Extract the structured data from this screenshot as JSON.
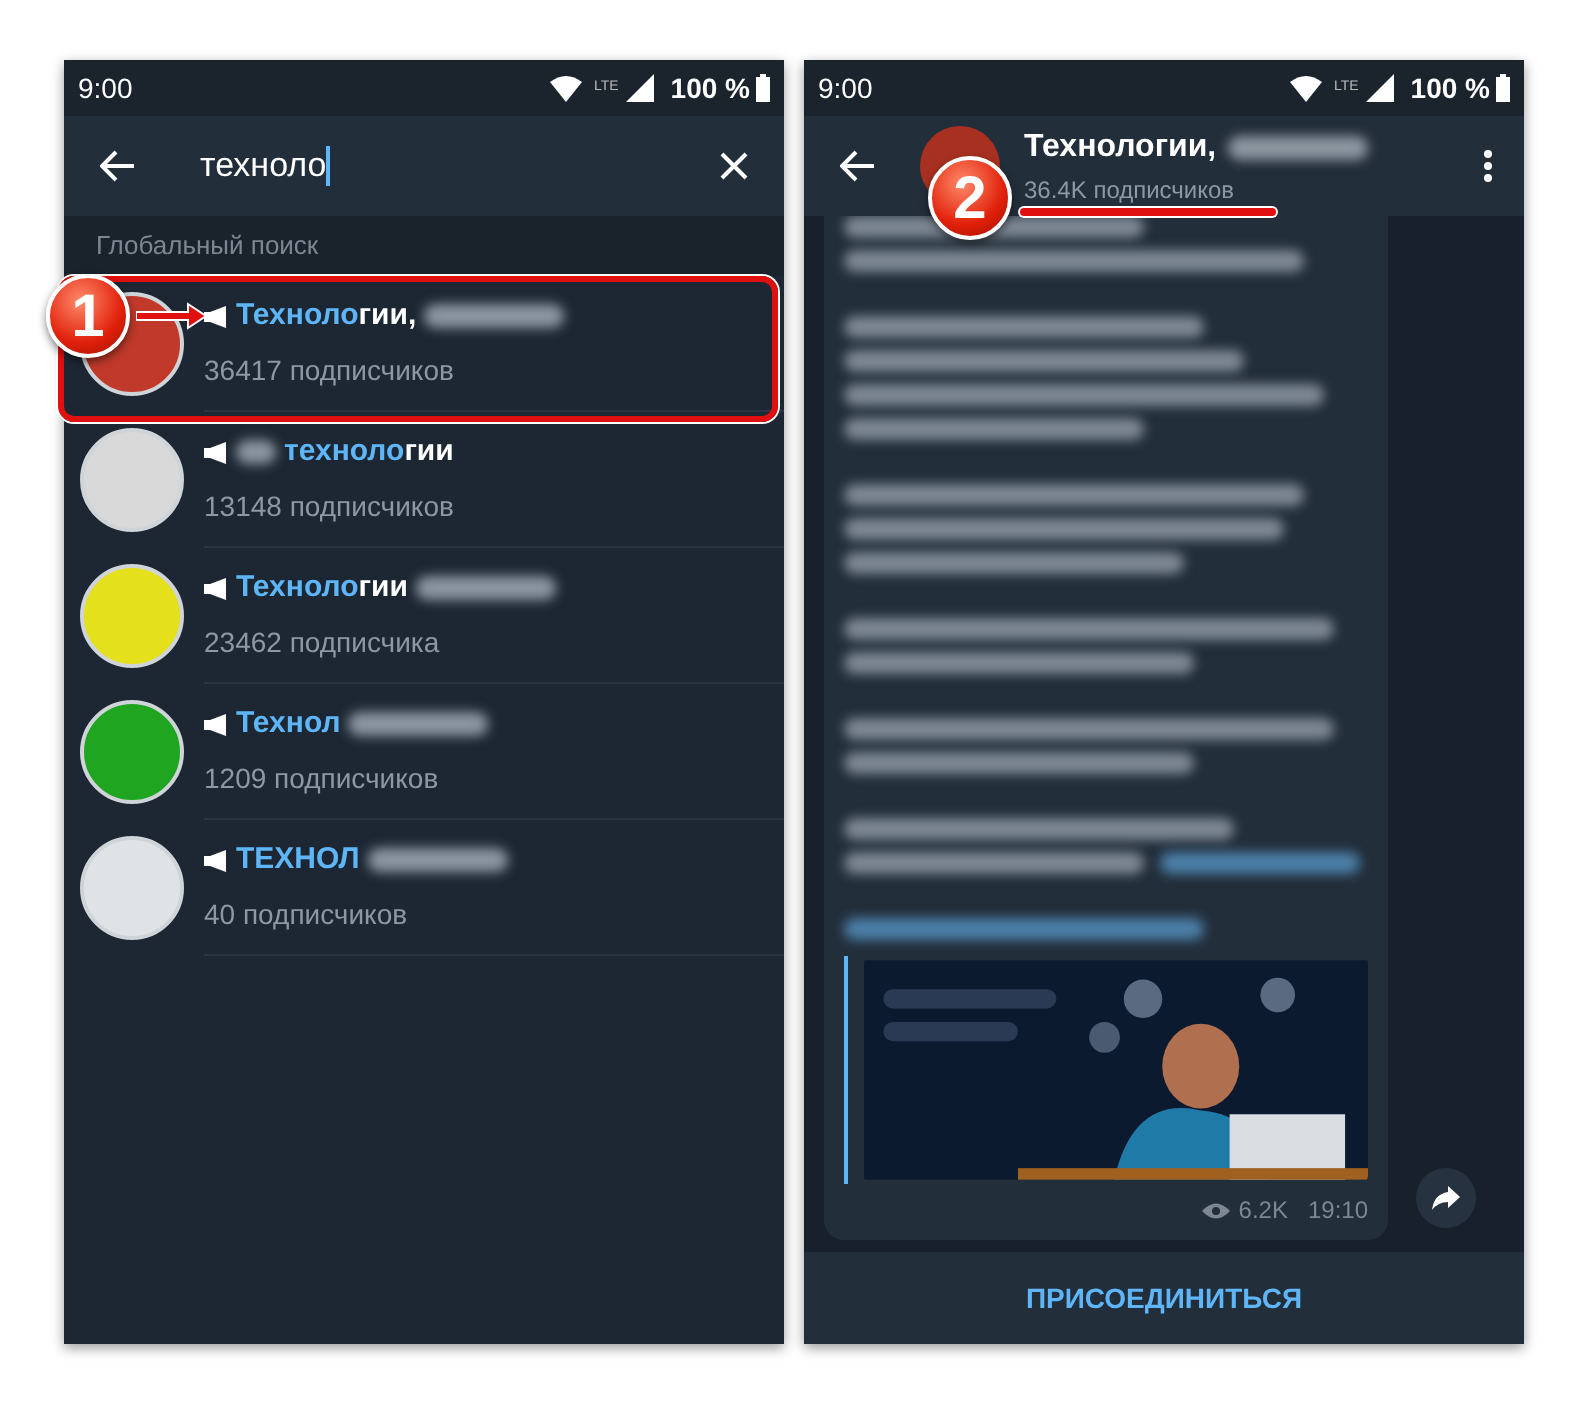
{
  "left_screen": {
    "status_bar": {
      "time": "9:00",
      "network": "LTE",
      "battery": "100 %"
    },
    "search": {
      "value": "техноло"
    },
    "section_title": "Глобальный поиск",
    "results": [
      {
        "blur_before": false,
        "match": "Техноло",
        "rest": "гии,",
        "blur_after": true,
        "subscribers": "36417 подписчиков",
        "color": "#c0392b"
      },
      {
        "blur_before": true,
        "match": "техноло",
        "rest": "гии",
        "blur_after": false,
        "subscribers": "13148 подписчиков",
        "color": "#d9d9d9"
      },
      {
        "blur_before": false,
        "match": "Техноло",
        "rest": "гии",
        "blur_after": true,
        "subscribers": "23462 подписчика",
        "color": "#e5e01c"
      },
      {
        "blur_before": false,
        "match": "Технол",
        "blur_after": true,
        "subscribers": "1209 подписчиков",
        "color": "#1fa51f"
      },
      {
        "blur_before": false,
        "match": "ТЕХНОЛ",
        "blur_after": true,
        "subscribers": "40 подписчиков",
        "color": "#dfe3e6"
      }
    ]
  },
  "right_screen": {
    "status_bar": {
      "time": "9:00",
      "network": "LTE",
      "battery": "100 %"
    },
    "channel": {
      "title": "Технологии,",
      "blur_after": true,
      "subscribers": "36.4K подписчиков"
    },
    "message": {
      "views": "6.2K",
      "time": "19:10"
    },
    "join_button": "ПРИСОЕДИНИТЬСЯ"
  },
  "annotations": [
    {
      "number": "1"
    },
    {
      "number": "2"
    }
  ]
}
